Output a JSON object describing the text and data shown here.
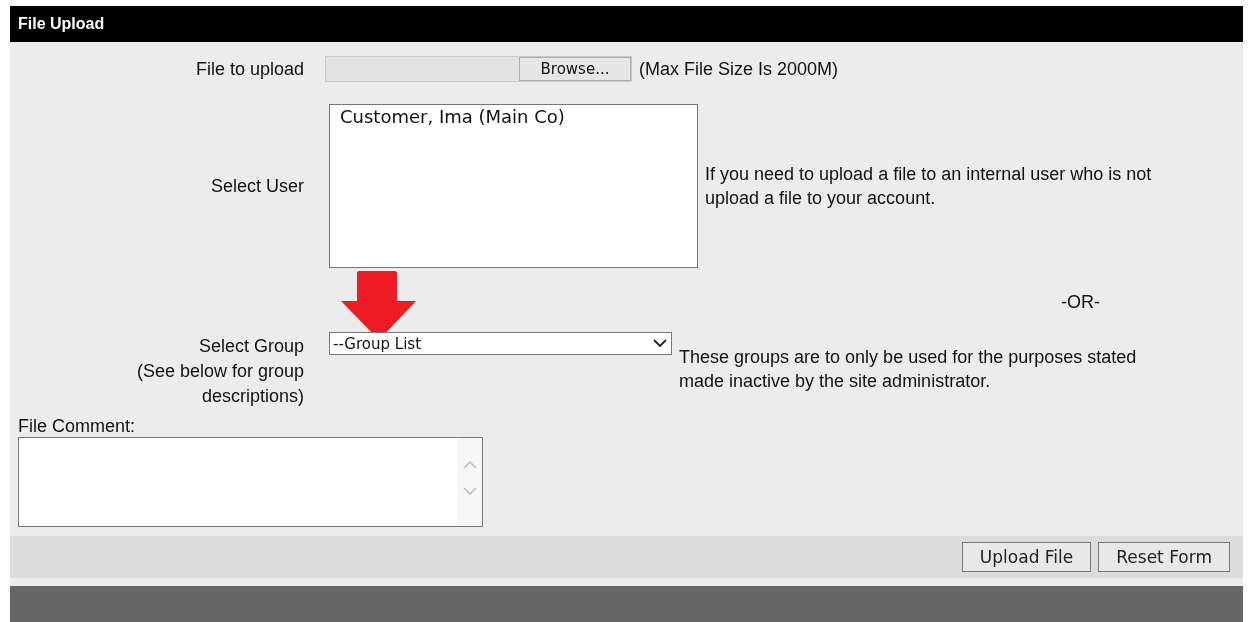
{
  "panel": {
    "title": "File Upload"
  },
  "file_field": {
    "label": "File to upload",
    "button": "Browse...",
    "hint": "(Max File Size Is 2000M)"
  },
  "user_field": {
    "label": "Select User",
    "options": [
      {
        "label": "Customer, Ima (Main Co)",
        "selected": false
      }
    ],
    "help_lines": [
      "If you need to upload a file to an internal user who is not",
      "upload a file to your account."
    ]
  },
  "separator": "-OR-",
  "group_field": {
    "label_lines": [
      "Select Group",
      "(See below for group",
      "descriptions)"
    ],
    "value": "--Group List",
    "help_lines": [
      "These groups are to only be used for the purposes stated",
      "made inactive by the site administrator."
    ]
  },
  "comment_field": {
    "label": "File Comment:"
  },
  "buttons": [
    "Upload File",
    "Reset Form"
  ]
}
